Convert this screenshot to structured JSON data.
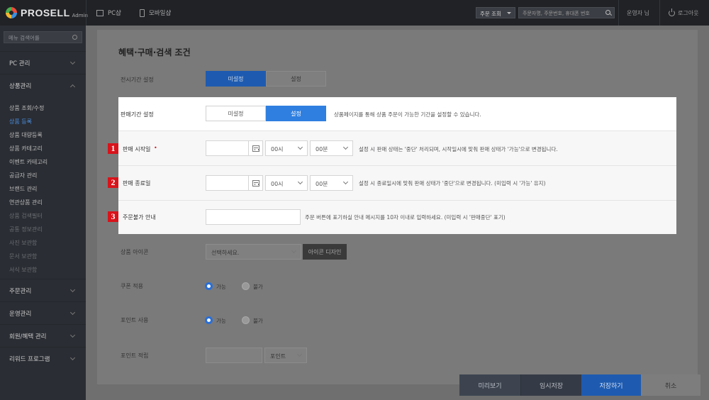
{
  "header": {
    "brand": "PROSELL",
    "brand_sub": "Admin",
    "nav_pc": "PC샵",
    "nav_mobile": "모바일샵",
    "order_select": "주문 조회",
    "search_placeholder": "주문자명, 주문번호, 휴대폰 번호",
    "user": "운영자 님",
    "logout": "로그아웃"
  },
  "sidebar": {
    "search_placeholder": "메뉴 검색어를",
    "menus": [
      {
        "label": "PC 관리"
      },
      {
        "label": "상품관리"
      },
      {
        "label": "주문관리"
      },
      {
        "label": "운영관리"
      },
      {
        "label": "회원/혜택 관리"
      },
      {
        "label": "리워드 프로그램"
      }
    ],
    "subitems": [
      {
        "label": "상품 조회/수정"
      },
      {
        "label": "상품 등록"
      },
      {
        "label": "상품 대량등록"
      },
      {
        "label": "상품 카테고리"
      },
      {
        "label": "이벤트 카테고리"
      },
      {
        "label": "공급자 관리"
      },
      {
        "label": "브랜드 관리"
      },
      {
        "label": "연관상품 관리"
      },
      {
        "label": "상품 검색필터"
      },
      {
        "label": "공통 정보관리"
      },
      {
        "label": "사진 보관함"
      },
      {
        "label": "문서 보관함"
      },
      {
        "label": "서식 보관함"
      }
    ]
  },
  "form": {
    "title": "혜택·구매·검색 조건",
    "display_period": {
      "label": "전시기간 설정",
      "unset": "미설정",
      "set": "설정"
    },
    "sale_period": {
      "label": "판매기간 설정",
      "unset": "미설정",
      "set": "설정",
      "help": "상품페이지를 통해 상품 주문이 가능한 기간을 설정할 수 있습니다."
    },
    "sale_start": {
      "badge": "1",
      "label": "판매 시작일",
      "required": "•",
      "hour": "00시",
      "minute": "00분",
      "help": "설정 시 판매 상태는 '중단' 처리되며, 시작일시에 맞춰 판매 상태가 '가능'으로 변경됩니다."
    },
    "sale_end": {
      "badge": "2",
      "label": "판매 종료일",
      "hour": "00시",
      "minute": "00분",
      "help": "설정 시 종료일시에 맞춰 판매 상태가 '중단'으로 변경됩니다. (미입력 시 '가능' 유지)"
    },
    "order_notice": {
      "badge": "3",
      "label": "주문불가 안내",
      "help": "주문 버튼에 표기하실 안내 메시지를 10자 이내로 입력하세요. (미입력 시 '판매중단' 표기)"
    },
    "icon": {
      "label": "상품 아이콘",
      "select": "선택하세요.",
      "design_button": "아이콘 디자인"
    },
    "coupon": {
      "label": "쿠폰 적용",
      "yes": "가능",
      "no": "불가"
    },
    "point_use": {
      "label": "포인트 사용",
      "yes": "가능",
      "no": "불가"
    },
    "point_earn": {
      "label": "포인트 적립",
      "unit": "포인트"
    }
  },
  "footer": {
    "preview": "미리보기",
    "temp_save": "임시저장",
    "save": "저장하기",
    "cancel": "취소"
  },
  "colors": {
    "primary": "#2a6fd6",
    "badge": "#d8131b",
    "sidebar": "#2a2d33",
    "topbar": "#202226"
  }
}
